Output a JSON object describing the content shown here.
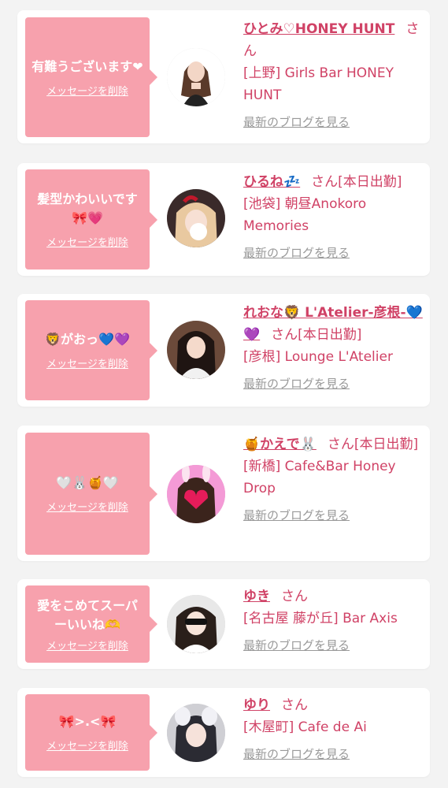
{
  "delete_label": "メッセージを削除",
  "blog_label": "最新のブログを見る",
  "colors": {
    "bubble": "#f7a1ad",
    "name_text": "#d04266",
    "link_gray": "#999999",
    "background": "#f3f3f3"
  },
  "cards": [
    {
      "message": "有難うございます❤",
      "name": "ひとみ♡HONEY HUNT",
      "suffix": "さん",
      "status": "",
      "shop": "[上野] Girls Bar HONEY HUNT"
    },
    {
      "message": "髪型かわいいです🎀💗",
      "name": "ひるね💤",
      "suffix": "さん",
      "status": "[本日出勤]",
      "shop": "[池袋] 朝昼Anokoro Memories"
    },
    {
      "message": "🦁がおっ💙💜",
      "name": "れおな🦁 L'Atelier-彦根-💙💜",
      "suffix": "さん",
      "status": "[本日出勤]",
      "shop": "[彦根] Lounge L'Atelier"
    },
    {
      "message": "🤍🐰🍯🤍",
      "name": "🍯かえで🐰",
      "suffix": "さん",
      "status": "[本日出勤]",
      "shop": "[新橋] Cafe&Bar Honey Drop"
    },
    {
      "message": "愛をこめてスーパーいいね🫶",
      "name": "ゆき",
      "suffix": "さん",
      "status": "",
      "shop": "[名古屋 藤が丘] Bar Axis"
    },
    {
      "message": "🎀>.<🎀",
      "name": "ゆり",
      "suffix": "さん",
      "status": "",
      "shop": "[木屋町] Cafe de Ai"
    }
  ]
}
